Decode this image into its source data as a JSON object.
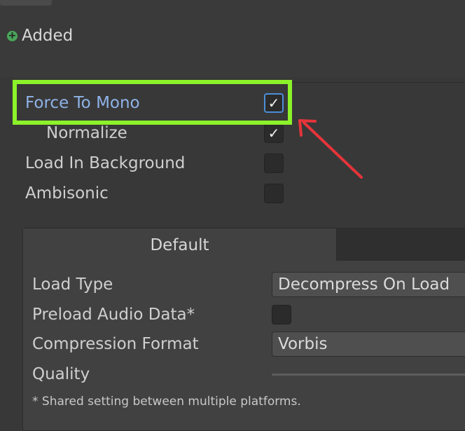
{
  "status": {
    "added_label": "Added",
    "added_icon": "plus-circle-icon"
  },
  "options": {
    "force_to_mono": {
      "label": "Force To Mono",
      "checked": true
    },
    "normalize": {
      "label": "Normalize",
      "checked": true
    },
    "load_in_background": {
      "label": "Load In Background",
      "checked": false
    },
    "ambisonic": {
      "label": "Ambisonic",
      "checked": false
    }
  },
  "annotation": {
    "highlight_color": "#8cf229",
    "arrow_color": "#e5343a"
  },
  "platform_panel": {
    "tab_label": "Default",
    "load_type": {
      "label": "Load Type",
      "value": "Decompress On Load"
    },
    "preload_audio_data": {
      "label": "Preload Audio Data*",
      "checked": false
    },
    "compression_format": {
      "label": "Compression Format",
      "value": "Vorbis"
    },
    "quality": {
      "label": "Quality"
    },
    "footnote": "* Shared setting between multiple platforms."
  },
  "check_glyph": "✓"
}
